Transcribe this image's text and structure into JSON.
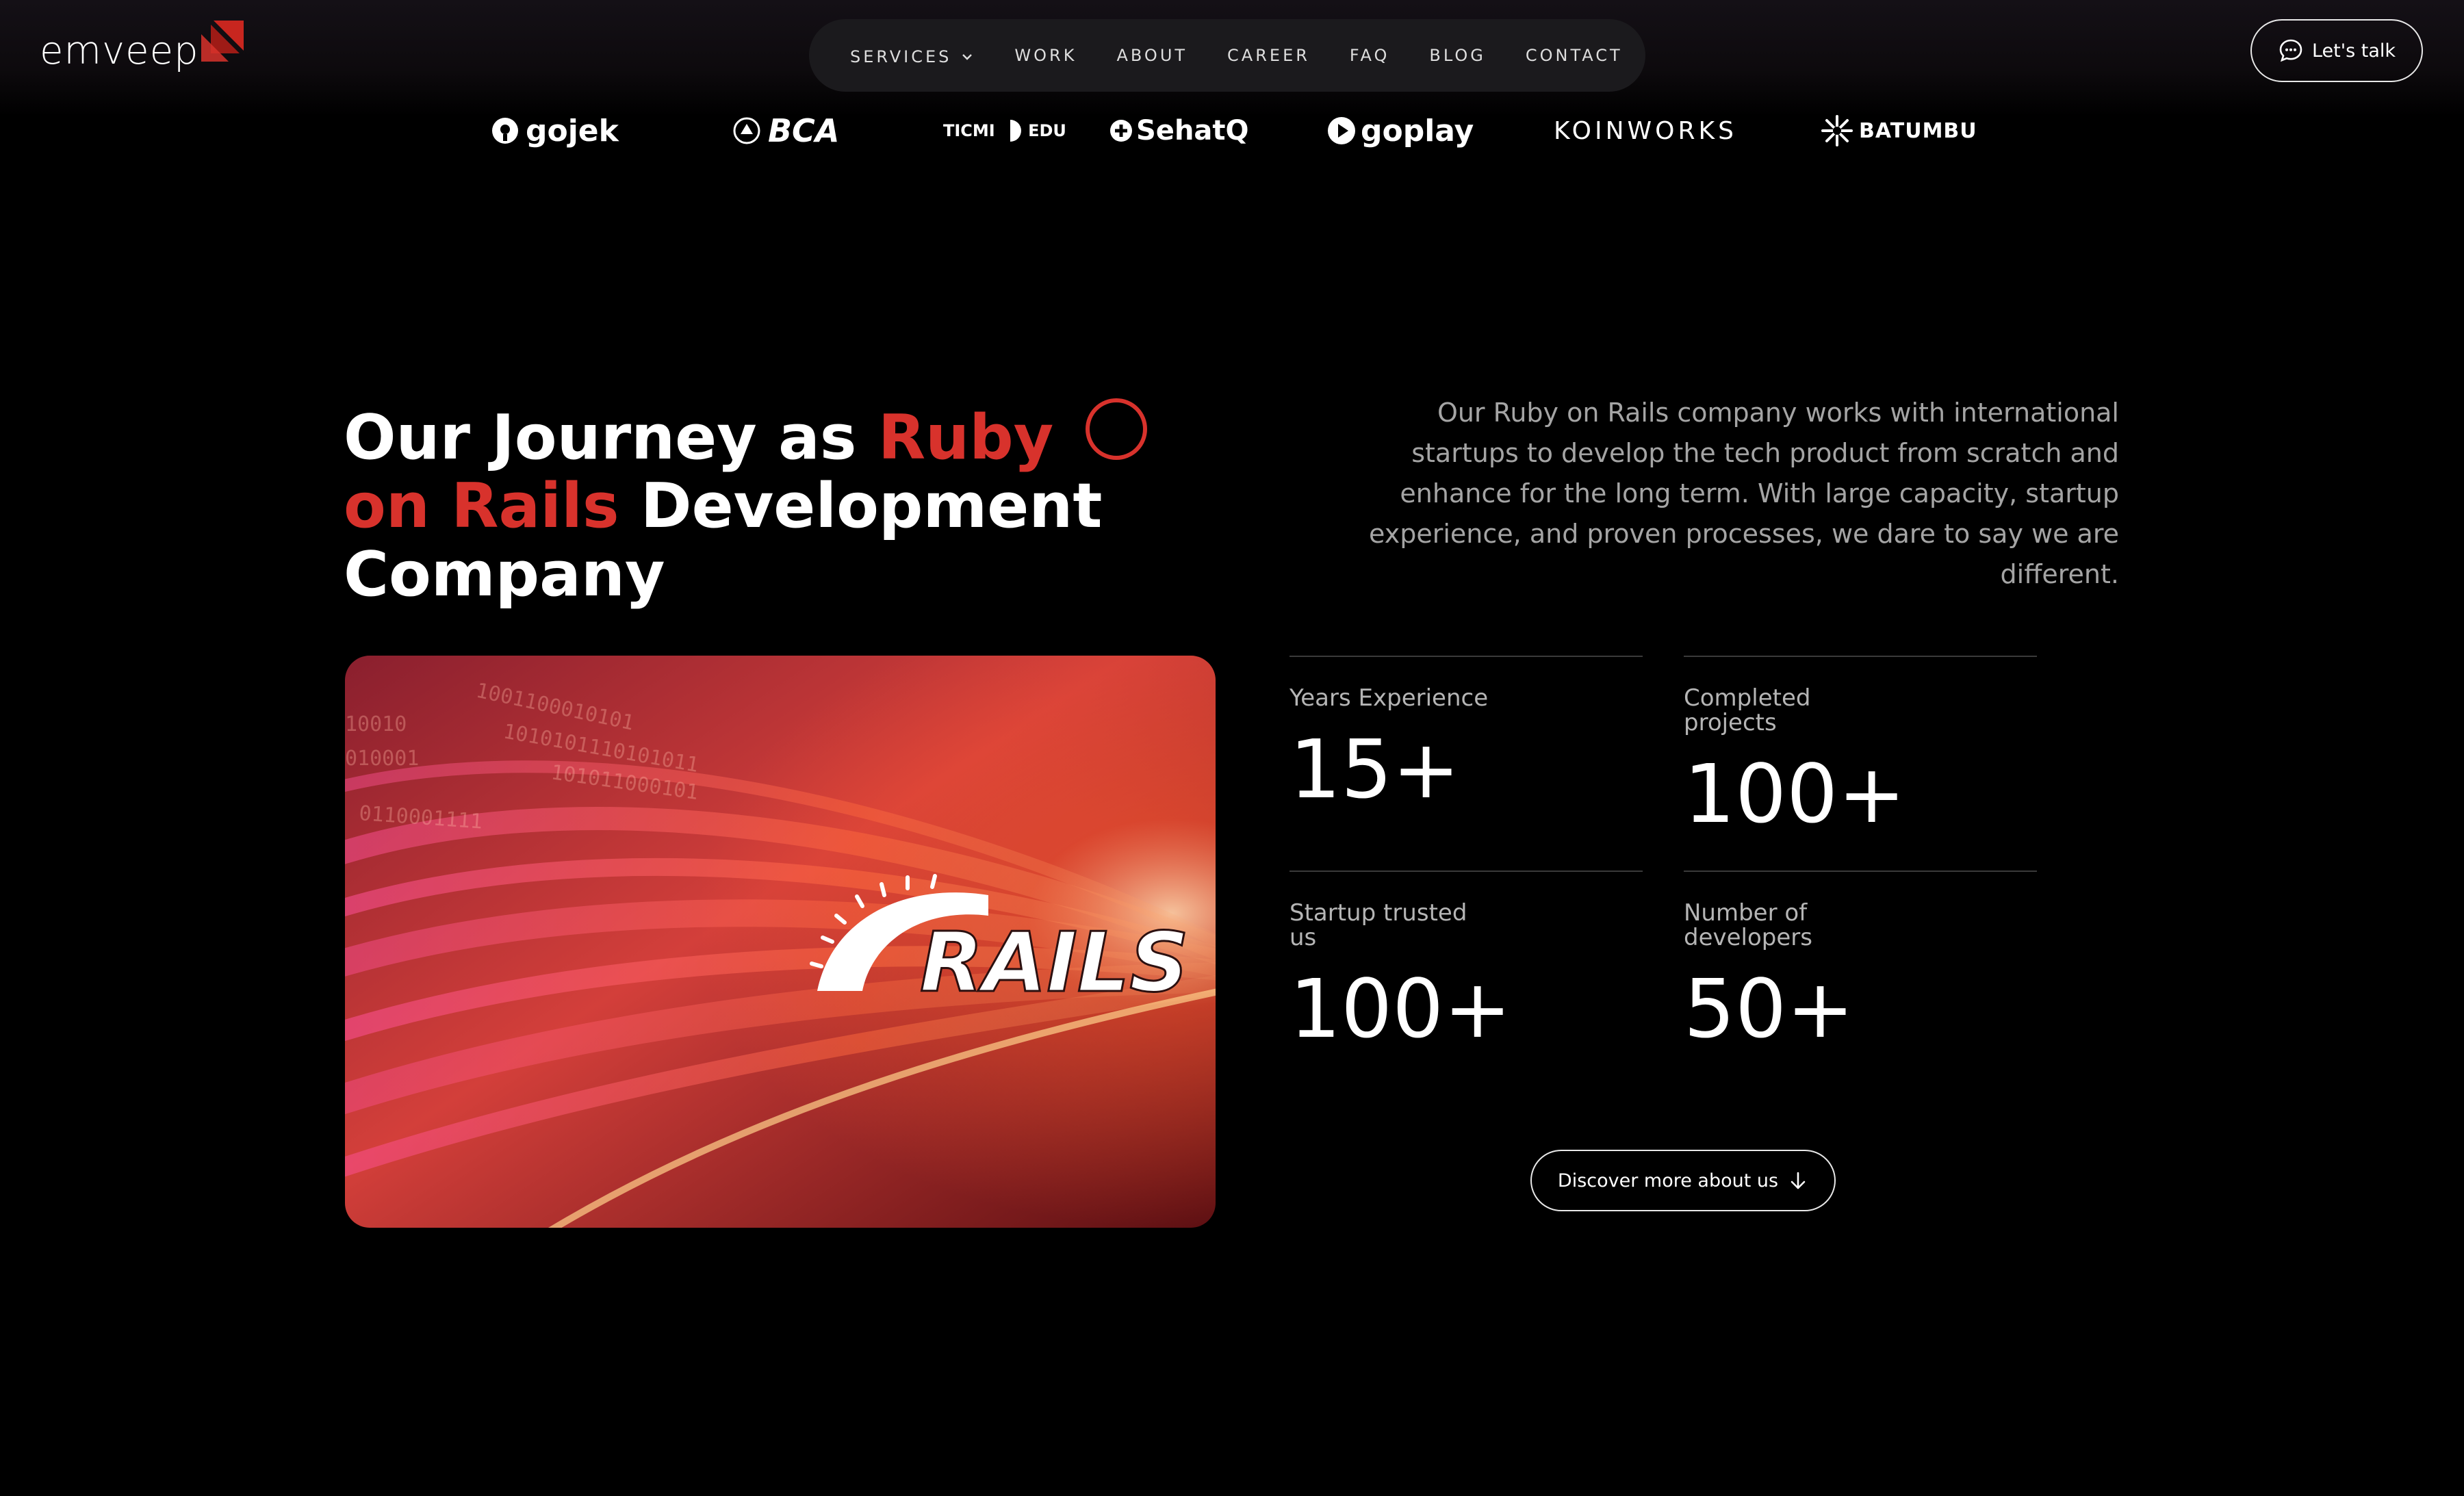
{
  "brand": {
    "name": "emveep"
  },
  "nav": {
    "items": [
      {
        "label": "SERVICES"
      },
      {
        "label": "WORK"
      },
      {
        "label": "ABOUT"
      },
      {
        "label": "CAREER"
      },
      {
        "label": "FAQ"
      },
      {
        "label": "BLOG"
      },
      {
        "label": "CONTACT"
      }
    ],
    "cta_label": "Let's talk"
  },
  "clients": [
    {
      "name": "gojek"
    },
    {
      "name": "BCA"
    },
    {
      "name": "TICMI EDU"
    },
    {
      "name": "SehatQ"
    },
    {
      "name": "goplay"
    },
    {
      "name": "KOINWORKS"
    },
    {
      "name": "BATUMBU"
    }
  ],
  "hero": {
    "title_part1": "Our Journey as ",
    "title_accent": "Ruby on Rails",
    "title_part2": " Development Company",
    "intro": "Our Ruby on Rails company works with international startups to develop the tech product from scratch and enhance for the long term. With large capacity, startup experience, and proven processes, we dare to say we are different.",
    "image_text": "RAILS"
  },
  "stats": [
    {
      "label": "Years Experience",
      "value": "15+"
    },
    {
      "label": "Completed projects",
      "value": "100+"
    },
    {
      "label": "Startup trusted us",
      "value": "100+"
    },
    {
      "label": "Number of developers",
      "value": "50+"
    }
  ],
  "discover": {
    "label": "Discover more about us"
  },
  "colors": {
    "accent": "#d8322c",
    "background": "#000000",
    "muted_text": "#a4a4a4"
  }
}
